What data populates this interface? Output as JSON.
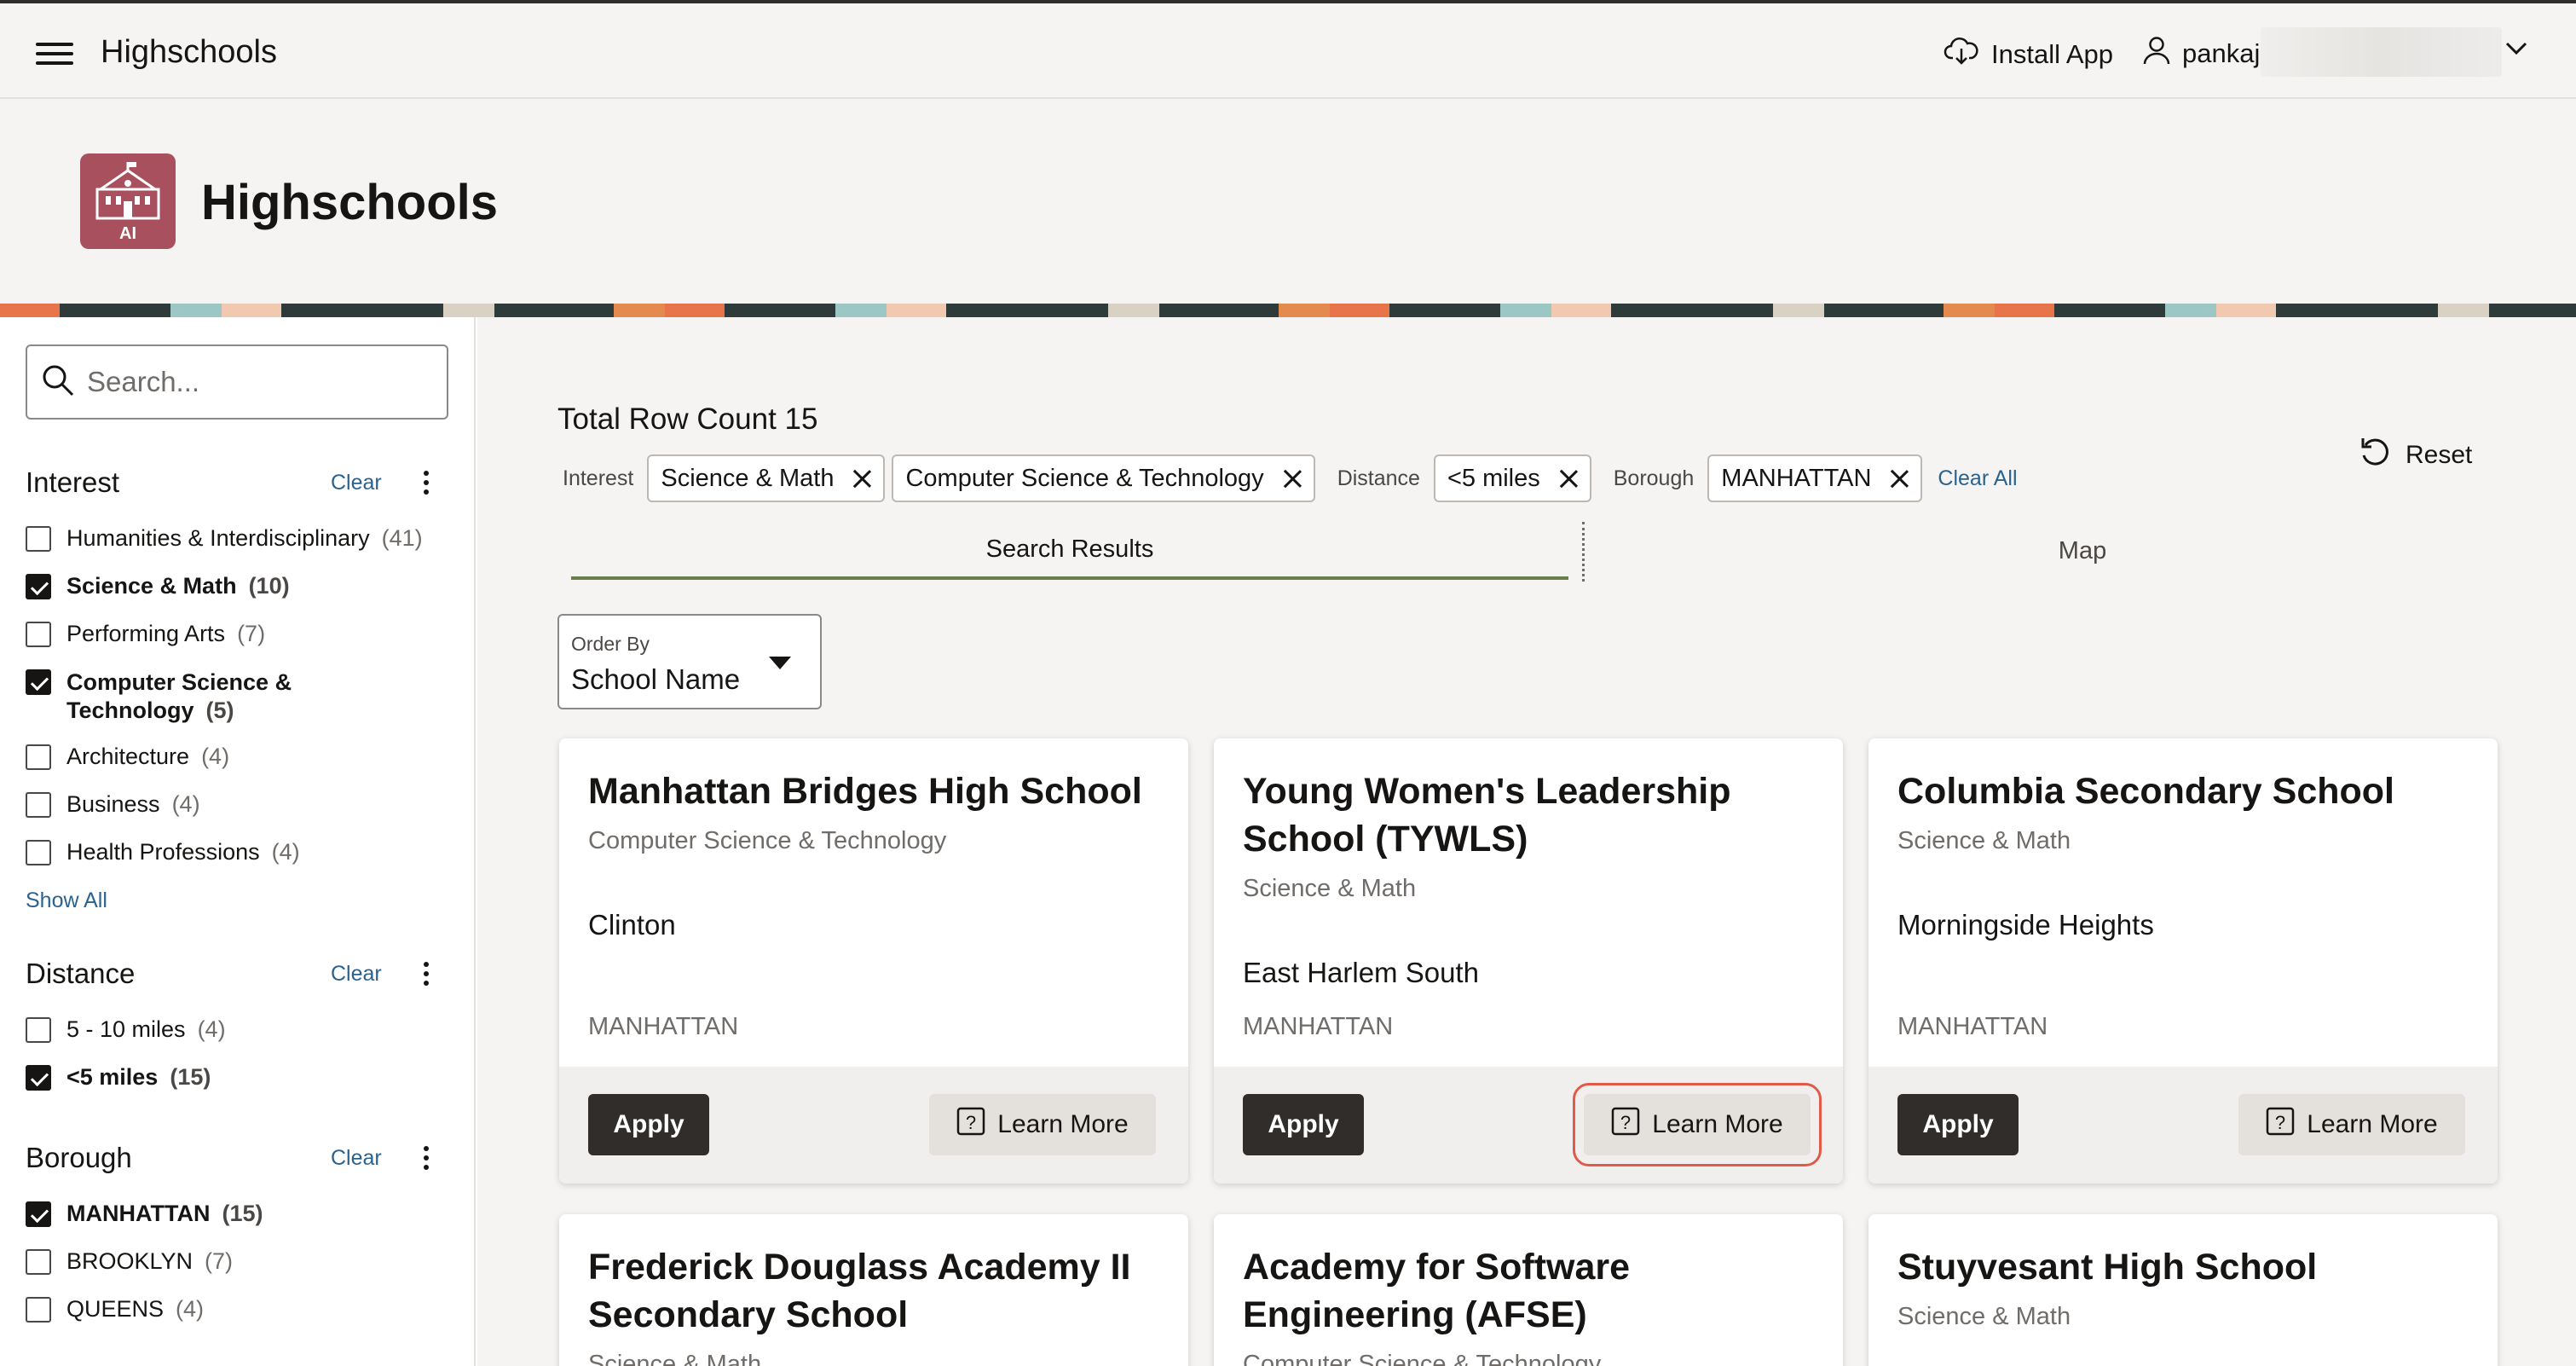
{
  "header": {
    "app_title": "Highschools",
    "install_label": "Install App",
    "username": "pankaj",
    "accent_color": "#312d2a"
  },
  "hero": {
    "title": "Highschools",
    "icon_badge": "AI",
    "icon_color": "#a8505e"
  },
  "sidebar": {
    "search_placeholder": "Search...",
    "facets": [
      {
        "title": "Interest",
        "clear_label": "Clear",
        "options": [
          {
            "label": "Humanities & Interdisciplinary",
            "count": "(41)",
            "checked": false
          },
          {
            "label": "Science & Math",
            "count": "(10)",
            "checked": true
          },
          {
            "label": "Performing Arts",
            "count": "(7)",
            "checked": false
          },
          {
            "label": "Computer Science & Technology",
            "count": "(5)",
            "checked": true
          },
          {
            "label": "Architecture",
            "count": "(4)",
            "checked": false
          },
          {
            "label": "Business",
            "count": "(4)",
            "checked": false
          },
          {
            "label": "Health Professions",
            "count": "(4)",
            "checked": false
          }
        ],
        "show_all_label": "Show All"
      },
      {
        "title": "Distance",
        "clear_label": "Clear",
        "options": [
          {
            "label": "5 - 10 miles",
            "count": "(4)",
            "checked": false
          },
          {
            "label": "<5 miles",
            "count": "(15)",
            "checked": true
          }
        ]
      },
      {
        "title": "Borough",
        "clear_label": "Clear",
        "options": [
          {
            "label": "MANHATTAN",
            "count": "(15)",
            "checked": true
          },
          {
            "label": "BROOKLYN",
            "count": "(7)",
            "checked": false
          },
          {
            "label": "QUEENS",
            "count": "(4)",
            "checked": false
          }
        ]
      }
    ]
  },
  "main": {
    "row_count_label": "Total Row Count 15",
    "reset_label": "Reset",
    "filters": {
      "interest_label": "Interest",
      "interest_chips": [
        "Science & Math",
        "Computer Science & Technology"
      ],
      "distance_label": "Distance",
      "distance_chips": [
        "<5 miles"
      ],
      "borough_label": "Borough",
      "borough_chips": [
        "MANHATTAN"
      ],
      "clear_all_label": "Clear All"
    },
    "tabs": [
      {
        "label": "Search Results",
        "active": true
      },
      {
        "label": "Map",
        "active": false
      }
    ],
    "order_by": {
      "label": "Order By",
      "value": "School Name"
    },
    "apply_label": "Apply",
    "learn_more_label": "Learn More",
    "cards": [
      {
        "name": "Manhattan Bridges High School",
        "interest": "Computer Science & Technology",
        "neighborhood": "Clinton",
        "borough": "MANHATTAN"
      },
      {
        "name": "Young Women's Leadership School (TYWLS)",
        "interest": "Science & Math",
        "neighborhood": "East Harlem South",
        "borough": "MANHATTAN"
      },
      {
        "name": "Columbia Secondary School",
        "interest": "Science & Math",
        "neighborhood": "Morningside Heights",
        "borough": "MANHATTAN"
      },
      {
        "name": "Frederick Douglass Academy II Secondary School",
        "interest": "Science & Math"
      },
      {
        "name": "Academy for Software Engineering (AFSE)",
        "interest": "Computer Science & Technology"
      },
      {
        "name": "Stuyvesant High School",
        "interest": "Science & Math"
      }
    ]
  }
}
